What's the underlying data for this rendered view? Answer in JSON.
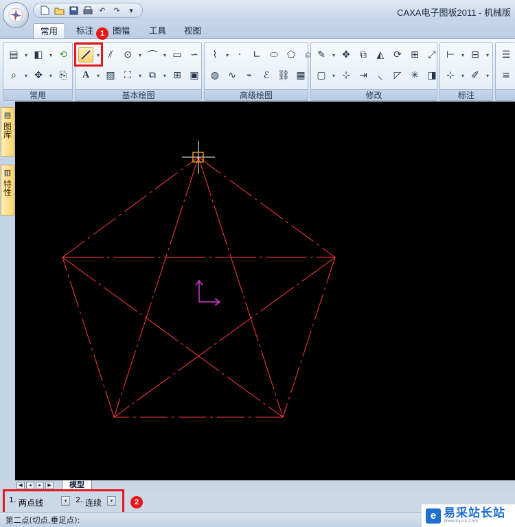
{
  "window": {
    "title": "CAXA电子图板2011 - 机械版"
  },
  "quick_access": {
    "icons": [
      "new-file-icon",
      "open-folder-icon",
      "save-icon",
      "print-icon",
      "undo-icon",
      "redo-icon",
      "customize-icon"
    ]
  },
  "ribbon_tabs": [
    {
      "label": "常用",
      "active": true
    },
    {
      "label": "标注",
      "active": false
    },
    {
      "label": "图幅",
      "active": false
    },
    {
      "label": "工具",
      "active": false
    },
    {
      "label": "视图",
      "active": false
    }
  ],
  "ribbon_groups": {
    "common": "常用",
    "basic": "基本绘图",
    "advanced": "高级绘图",
    "modify": "修改",
    "annotate": "标注"
  },
  "annotations": {
    "badge1": "1",
    "badge2": "2"
  },
  "side_panels": [
    "图库",
    "特性"
  ],
  "sheet": {
    "model_tab": "模型"
  },
  "command_options": [
    {
      "num": "1.",
      "value": "两点线"
    },
    {
      "num": "2.",
      "value": "连续"
    }
  ],
  "status": {
    "prompt": "第二点(切点,垂足点):"
  },
  "watermark": {
    "mark": "e",
    "name": "易采站长站",
    "sub": "Www.Easck.Com"
  },
  "colors": {
    "canvas_bg": "#000000",
    "line_color": "#ff3b3b",
    "accent_red": "#e8161b",
    "ucs_color": "#d23cd2",
    "cursor_box": "#e8a020"
  }
}
